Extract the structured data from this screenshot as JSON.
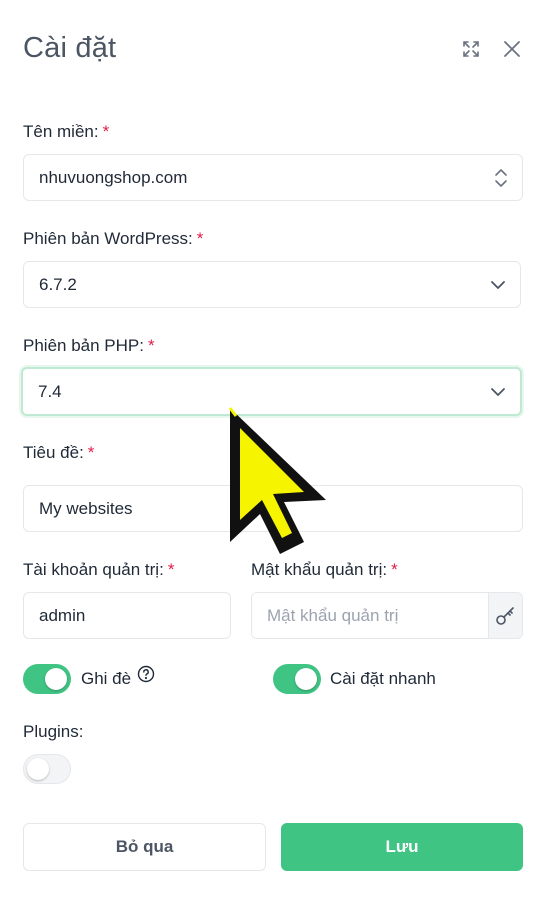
{
  "dialog": {
    "title": "Cài đặt",
    "colors": {
      "accent": "#3fc483",
      "required": "#e11d48"
    }
  },
  "form": {
    "domain": {
      "label": "Tên miền:",
      "required_mark": "*",
      "value": "nhuvuongshop.com"
    },
    "wordpress_version": {
      "label": "Phiên bản WordPress:",
      "required_mark": "*",
      "value": "6.7.2"
    },
    "php_version": {
      "label": "Phiên bản PHP:",
      "required_mark": "*",
      "value": "7.4"
    },
    "site_title": {
      "label": "Tiêu đề:",
      "required_mark": "*",
      "value": "My websites"
    },
    "admin_user": {
      "label": "Tài khoản quản trị:",
      "required_mark": "*",
      "value": "admin"
    },
    "admin_password": {
      "label": "Mật khẩu quản trị:",
      "required_mark": "*",
      "value": "",
      "placeholder": "Mật khẩu quản trị"
    },
    "overwrite": {
      "label": "Ghi đè",
      "on": true
    },
    "quick_install": {
      "label": "Cài đặt nhanh",
      "on": true
    },
    "plugins": {
      "label": "Plugins:",
      "on": false
    }
  },
  "footer": {
    "cancel_label": "Bỏ qua",
    "save_label": "Lưu"
  }
}
